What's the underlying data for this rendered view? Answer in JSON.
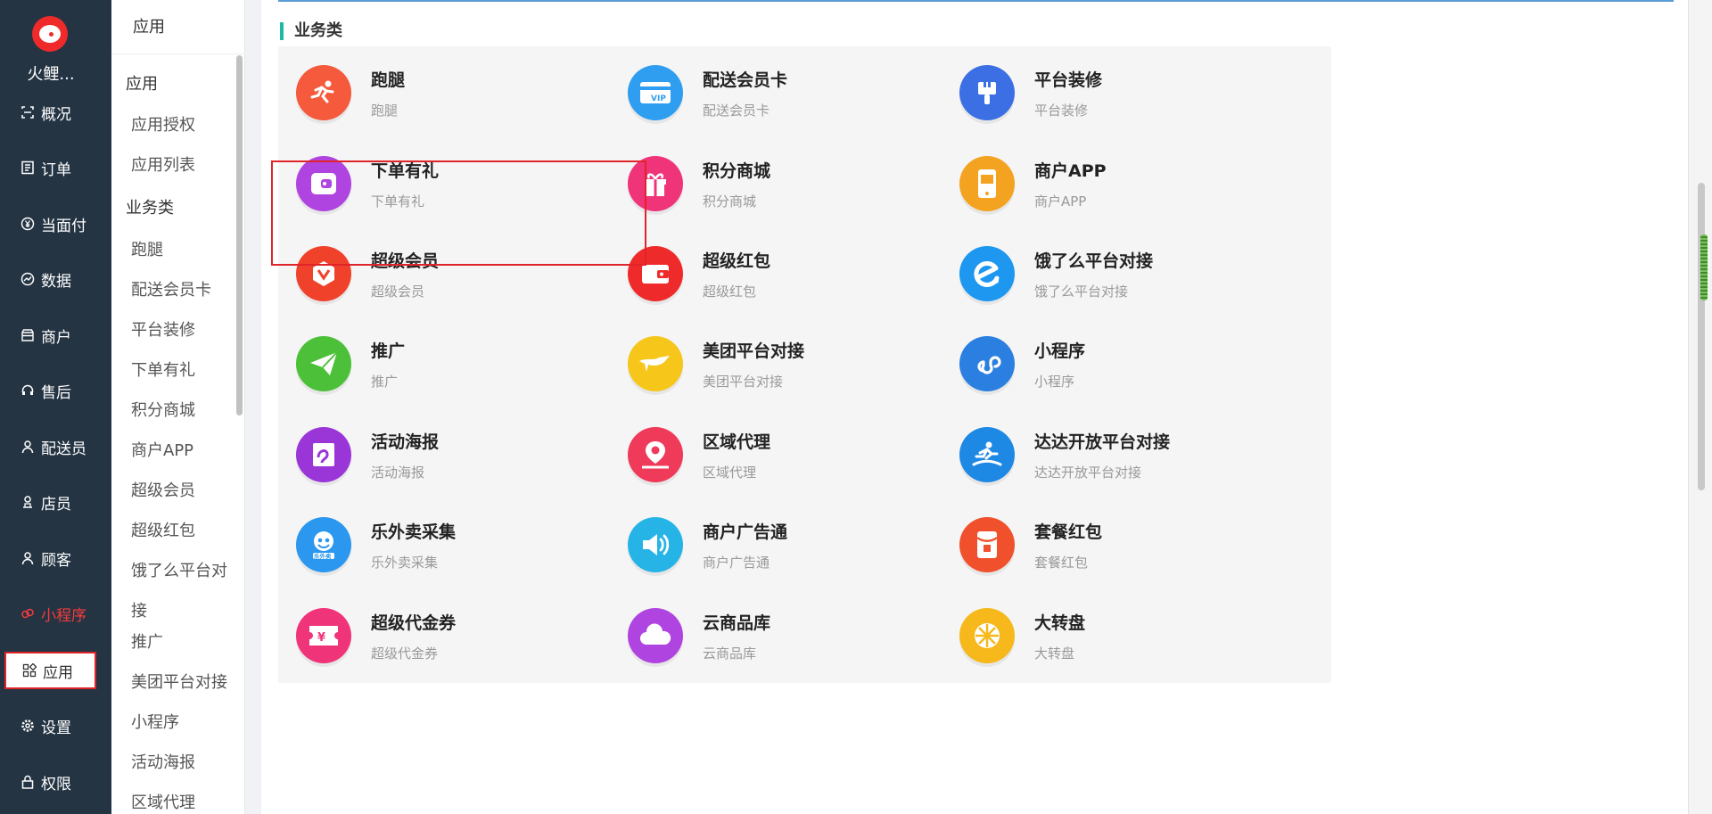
{
  "brand": {
    "name": "火鲤..."
  },
  "nav": [
    {
      "label": "概况",
      "icon": "overview-icon"
    },
    {
      "label": "订单",
      "icon": "order-icon"
    },
    {
      "label": "当面付",
      "icon": "yen-icon"
    },
    {
      "label": "数据",
      "icon": "chart-icon"
    },
    {
      "label": "商户",
      "icon": "store-icon"
    },
    {
      "label": "售后",
      "icon": "headset-icon"
    },
    {
      "label": "配送员",
      "icon": "user-icon"
    },
    {
      "label": "店员",
      "icon": "staff-icon"
    },
    {
      "label": "顾客",
      "icon": "customer-icon"
    },
    {
      "label": "小程序",
      "icon": "miniapp-icon"
    },
    {
      "label": "应用",
      "icon": "apps-grid-icon"
    },
    {
      "label": "设置",
      "icon": "gear-icon"
    },
    {
      "label": "权限",
      "icon": "lock-icon"
    }
  ],
  "subnav": {
    "head": "应用",
    "items": [
      "应用",
      "应用授权",
      "应用列表",
      "业务类",
      "跑腿",
      "配送会员卡",
      "平台装修",
      "下单有礼",
      "积分商城",
      "商户APP",
      "超级会员",
      "超级红包",
      "饿了么平台对",
      "接",
      "推广",
      "美团平台对接",
      "小程序",
      "活动海报",
      "区域代理"
    ]
  },
  "main": {
    "section_title": "业务类",
    "cards": [
      {
        "title": "跑腿",
        "desc": "跑腿",
        "icon": "runner-icon",
        "color": "#f55a3c"
      },
      {
        "title": "配送会员卡",
        "desc": "配送会员卡",
        "icon": "vip-card-icon",
        "color": "#2f9ef0"
      },
      {
        "title": "平台装修",
        "desc": "平台装修",
        "icon": "paint-brush-icon",
        "color": "#3b6fe3"
      },
      {
        "title": "下单有礼",
        "desc": "下单有礼",
        "icon": "wallet-icon",
        "color": "#b044e0"
      },
      {
        "title": "积分商城",
        "desc": "积分商城",
        "icon": "gift-icon",
        "color": "#f0347a"
      },
      {
        "title": "商户APP",
        "desc": "商户APP",
        "icon": "phone-app-icon",
        "color": "#f3a31f"
      },
      {
        "title": "超级会员",
        "desc": "超级会员",
        "icon": "super-member-icon",
        "color": "#f0412b"
      },
      {
        "title": "超级红包",
        "desc": "超级红包",
        "icon": "red-packet-icon",
        "color": "#ee2a2a"
      },
      {
        "title": "饿了么平台对接",
        "desc": "饿了么平台对接",
        "icon": "eleme-icon",
        "color": "#1e97f0"
      },
      {
        "title": "推广",
        "desc": "推广",
        "icon": "paper-plane-icon",
        "color": "#4dc03a"
      },
      {
        "title": "美团平台对接",
        "desc": "美团平台对接",
        "icon": "meituan-icon",
        "color": "#f6c61b"
      },
      {
        "title": "小程序",
        "desc": "小程序",
        "icon": "miniprogram-icon",
        "color": "#2b7fe0"
      },
      {
        "title": "活动海报",
        "desc": "活动海报",
        "icon": "poster-icon",
        "color": "#9a36d8"
      },
      {
        "title": "区域代理",
        "desc": "区域代理",
        "icon": "location-icon",
        "color": "#ef3a5a"
      },
      {
        "title": "达达开放平台对接",
        "desc": "达达开放平台对接",
        "icon": "dada-icon",
        "color": "#1e88e5"
      },
      {
        "title": "乐外卖采集",
        "desc": "乐外卖采集",
        "icon": "lewaimai-icon",
        "color": "#2b97ef"
      },
      {
        "title": "商户广告通",
        "desc": "商户广告通",
        "icon": "speaker-icon",
        "color": "#26b4e6"
      },
      {
        "title": "套餐红包",
        "desc": "套餐红包",
        "icon": "envelope-icon",
        "color": "#f0502c"
      },
      {
        "title": "超级代金券",
        "desc": "超级代金券",
        "icon": "voucher-icon",
        "color": "#f0347a"
      },
      {
        "title": "云商品库",
        "desc": "云商品库",
        "icon": "cloud-icon",
        "color": "#b044e0"
      },
      {
        "title": "大转盘",
        "desc": "大转盘",
        "icon": "wheel-icon",
        "color": "#f6b81b"
      }
    ]
  }
}
